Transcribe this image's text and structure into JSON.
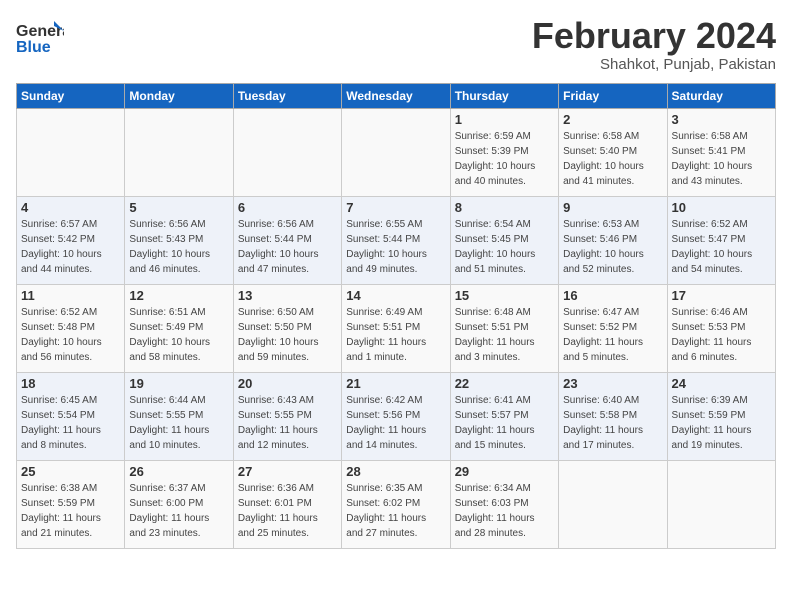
{
  "header": {
    "logo_general": "General",
    "logo_blue": "Blue",
    "month_title": "February 2024",
    "subtitle": "Shahkot, Punjab, Pakistan"
  },
  "days_of_week": [
    "Sunday",
    "Monday",
    "Tuesday",
    "Wednesday",
    "Thursday",
    "Friday",
    "Saturday"
  ],
  "weeks": [
    [
      {
        "day": "",
        "info": ""
      },
      {
        "day": "",
        "info": ""
      },
      {
        "day": "",
        "info": ""
      },
      {
        "day": "",
        "info": ""
      },
      {
        "day": "1",
        "info": "Sunrise: 6:59 AM\nSunset: 5:39 PM\nDaylight: 10 hours\nand 40 minutes."
      },
      {
        "day": "2",
        "info": "Sunrise: 6:58 AM\nSunset: 5:40 PM\nDaylight: 10 hours\nand 41 minutes."
      },
      {
        "day": "3",
        "info": "Sunrise: 6:58 AM\nSunset: 5:41 PM\nDaylight: 10 hours\nand 43 minutes."
      }
    ],
    [
      {
        "day": "4",
        "info": "Sunrise: 6:57 AM\nSunset: 5:42 PM\nDaylight: 10 hours\nand 44 minutes."
      },
      {
        "day": "5",
        "info": "Sunrise: 6:56 AM\nSunset: 5:43 PM\nDaylight: 10 hours\nand 46 minutes."
      },
      {
        "day": "6",
        "info": "Sunrise: 6:56 AM\nSunset: 5:44 PM\nDaylight: 10 hours\nand 47 minutes."
      },
      {
        "day": "7",
        "info": "Sunrise: 6:55 AM\nSunset: 5:44 PM\nDaylight: 10 hours\nand 49 minutes."
      },
      {
        "day": "8",
        "info": "Sunrise: 6:54 AM\nSunset: 5:45 PM\nDaylight: 10 hours\nand 51 minutes."
      },
      {
        "day": "9",
        "info": "Sunrise: 6:53 AM\nSunset: 5:46 PM\nDaylight: 10 hours\nand 52 minutes."
      },
      {
        "day": "10",
        "info": "Sunrise: 6:52 AM\nSunset: 5:47 PM\nDaylight: 10 hours\nand 54 minutes."
      }
    ],
    [
      {
        "day": "11",
        "info": "Sunrise: 6:52 AM\nSunset: 5:48 PM\nDaylight: 10 hours\nand 56 minutes."
      },
      {
        "day": "12",
        "info": "Sunrise: 6:51 AM\nSunset: 5:49 PM\nDaylight: 10 hours\nand 58 minutes."
      },
      {
        "day": "13",
        "info": "Sunrise: 6:50 AM\nSunset: 5:50 PM\nDaylight: 10 hours\nand 59 minutes."
      },
      {
        "day": "14",
        "info": "Sunrise: 6:49 AM\nSunset: 5:51 PM\nDaylight: 11 hours\nand 1 minute."
      },
      {
        "day": "15",
        "info": "Sunrise: 6:48 AM\nSunset: 5:51 PM\nDaylight: 11 hours\nand 3 minutes."
      },
      {
        "day": "16",
        "info": "Sunrise: 6:47 AM\nSunset: 5:52 PM\nDaylight: 11 hours\nand 5 minutes."
      },
      {
        "day": "17",
        "info": "Sunrise: 6:46 AM\nSunset: 5:53 PM\nDaylight: 11 hours\nand 6 minutes."
      }
    ],
    [
      {
        "day": "18",
        "info": "Sunrise: 6:45 AM\nSunset: 5:54 PM\nDaylight: 11 hours\nand 8 minutes."
      },
      {
        "day": "19",
        "info": "Sunrise: 6:44 AM\nSunset: 5:55 PM\nDaylight: 11 hours\nand 10 minutes."
      },
      {
        "day": "20",
        "info": "Sunrise: 6:43 AM\nSunset: 5:55 PM\nDaylight: 11 hours\nand 12 minutes."
      },
      {
        "day": "21",
        "info": "Sunrise: 6:42 AM\nSunset: 5:56 PM\nDaylight: 11 hours\nand 14 minutes."
      },
      {
        "day": "22",
        "info": "Sunrise: 6:41 AM\nSunset: 5:57 PM\nDaylight: 11 hours\nand 15 minutes."
      },
      {
        "day": "23",
        "info": "Sunrise: 6:40 AM\nSunset: 5:58 PM\nDaylight: 11 hours\nand 17 minutes."
      },
      {
        "day": "24",
        "info": "Sunrise: 6:39 AM\nSunset: 5:59 PM\nDaylight: 11 hours\nand 19 minutes."
      }
    ],
    [
      {
        "day": "25",
        "info": "Sunrise: 6:38 AM\nSunset: 5:59 PM\nDaylight: 11 hours\nand 21 minutes."
      },
      {
        "day": "26",
        "info": "Sunrise: 6:37 AM\nSunset: 6:00 PM\nDaylight: 11 hours\nand 23 minutes."
      },
      {
        "day": "27",
        "info": "Sunrise: 6:36 AM\nSunset: 6:01 PM\nDaylight: 11 hours\nand 25 minutes."
      },
      {
        "day": "28",
        "info": "Sunrise: 6:35 AM\nSunset: 6:02 PM\nDaylight: 11 hours\nand 27 minutes."
      },
      {
        "day": "29",
        "info": "Sunrise: 6:34 AM\nSunset: 6:03 PM\nDaylight: 11 hours\nand 28 minutes."
      },
      {
        "day": "",
        "info": ""
      },
      {
        "day": "",
        "info": ""
      }
    ]
  ]
}
